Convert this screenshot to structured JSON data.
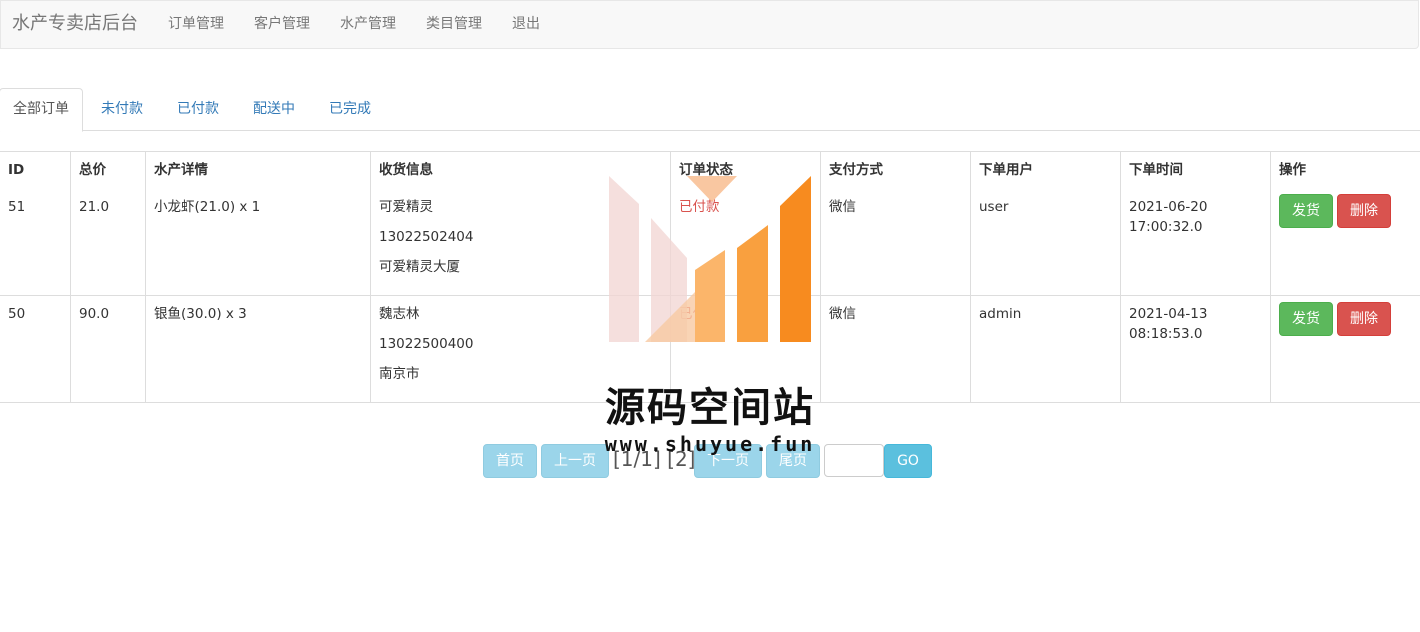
{
  "navbar": {
    "brand": "水产专卖店后台",
    "links": [
      "订单管理",
      "客户管理",
      "水产管理",
      "类目管理",
      "退出"
    ]
  },
  "tabs": [
    "全部订单",
    "未付款",
    "已付款",
    "配送中",
    "已完成"
  ],
  "active_tab": "全部订单",
  "table": {
    "headers": [
      "ID",
      "总价",
      "水产详情",
      "收货信息",
      "订单状态",
      "支付方式",
      "下单用户",
      "下单时间",
      "操作"
    ],
    "rows": [
      {
        "id": "51",
        "total": "21.0",
        "detail": "小龙虾(21.0) x 1",
        "receiver_name": "可爱精灵",
        "receiver_phone": "13022502404",
        "receiver_address": "可爱精灵大厦",
        "status": "已付款",
        "payment": "微信",
        "user": "user",
        "time_date": "2021-06-20",
        "time_clock": "17:00:32.0",
        "ship_label": "发货",
        "delete_label": "删除"
      },
      {
        "id": "50",
        "total": "90.0",
        "detail": "银鱼(30.0) x 3",
        "receiver_name": "魏志林",
        "receiver_phone": "13022500400",
        "receiver_address": "南京市",
        "status": "已付款",
        "payment": "微信",
        "user": "admin",
        "time_date": "2021-04-13",
        "time_clock": "08:18:53.0",
        "ship_label": "发货",
        "delete_label": "删除"
      }
    ]
  },
  "pagination": {
    "first": "首页",
    "prev": "上一页",
    "indicator": "[1/1] [2]",
    "next": "下一页",
    "last": "尾页",
    "input_value": "",
    "go": "GO"
  },
  "watermark": {
    "title": "源码空间站",
    "url": "www.shuyue.fun"
  },
  "colors": {
    "link": "#337ab7",
    "status_paid": "#d9534f",
    "success": "#5cb85c",
    "danger": "#d9534f",
    "pager_btn": "#9bd5ea",
    "go_btn": "#5bc0de",
    "watermark_orange": "#f78b1f"
  }
}
